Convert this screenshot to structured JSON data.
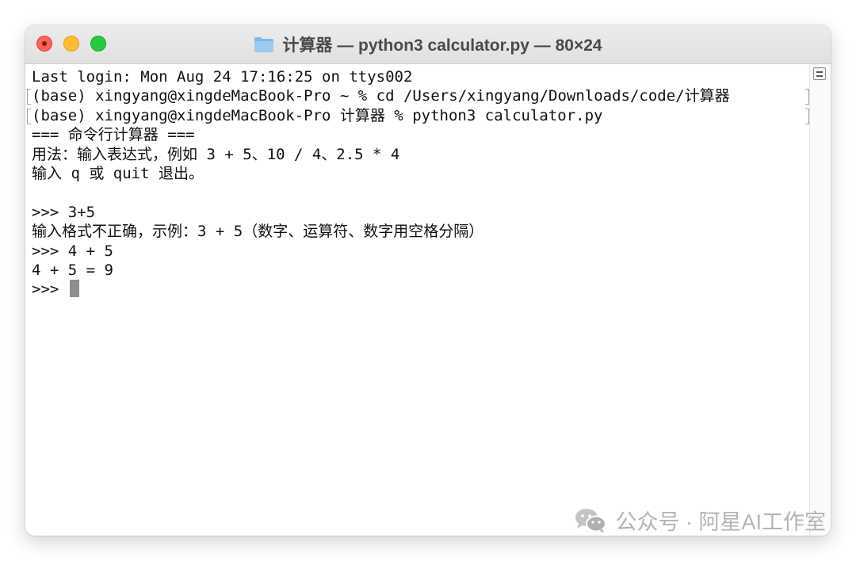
{
  "window": {
    "title": "计算器 — python3 calculator.py — 80×24"
  },
  "terminal": {
    "lines": [
      {
        "text": "Last login: Mon Aug 24 17:16:25 on ttys002",
        "marked": false
      },
      {
        "text": "(base) xingyang@xingdeMacBook-Pro ~ % cd /Users/xingyang/Downloads/code/计算器",
        "marked": true
      },
      {
        "text": "(base) xingyang@xingdeMacBook-Pro 计算器 % python3 calculator.py",
        "marked": true
      },
      {
        "text": "=== 命令行计算器 ===",
        "marked": false
      },
      {
        "text": "用法：输入表达式，例如 3 + 5、10 / 4、2.5 * 4",
        "marked": false
      },
      {
        "text": "输入 q 或 quit 退出。",
        "marked": false
      },
      {
        "text": "",
        "marked": false
      },
      {
        "text": ">>> 3+5",
        "marked": false
      },
      {
        "text": "输入格式不正确，示例：3 + 5（数字、运算符、数字用空格分隔）",
        "marked": false
      },
      {
        "text": ">>> 4 + 5",
        "marked": false
      },
      {
        "text": "4 + 5 = 9",
        "marked": false
      }
    ],
    "prompt": ">>> "
  },
  "watermark": {
    "text": "公众号 · 阿星AI工作室"
  },
  "colors": {
    "close": "#fe5f57",
    "minimize": "#febc2e",
    "zoom": "#28c840",
    "folder": "#7fb8e6"
  },
  "icons": [
    "folder-icon",
    "menu-icon",
    "wechat-icon"
  ]
}
